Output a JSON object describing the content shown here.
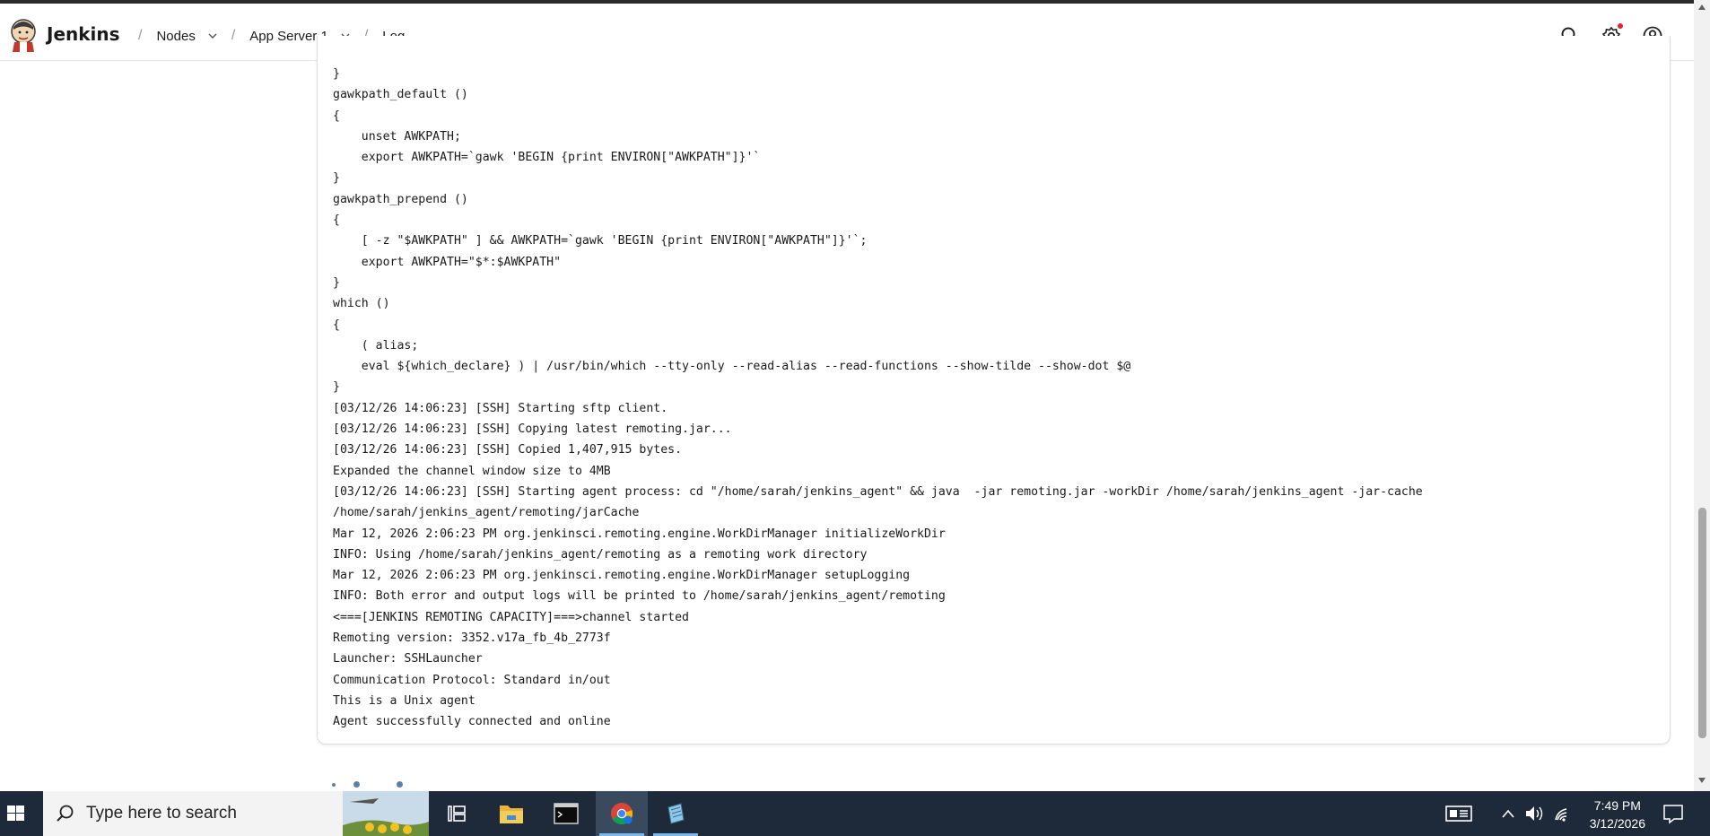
{
  "header": {
    "brand": "Jenkins",
    "breadcrumbs": [
      {
        "label": "Nodes",
        "has_menu": true
      },
      {
        "label": "App Server 1",
        "has_menu": true
      },
      {
        "label": "Log",
        "has_menu": false
      }
    ],
    "separator": "/",
    "icons": [
      "search-icon",
      "settings-icon",
      "user-icon"
    ],
    "notification_color": "#e5222e"
  },
  "log": {
    "lines": [
      "}",
      "gawkpath_default ()",
      "{",
      "    unset AWKPATH;",
      "    export AWKPATH=`gawk 'BEGIN {print ENVIRON[\"AWKPATH\"]}'`",
      "}",
      "gawkpath_prepend ()",
      "{",
      "    [ -z \"$AWKPATH\" ] && AWKPATH=`gawk 'BEGIN {print ENVIRON[\"AWKPATH\"]}'`;",
      "    export AWKPATH=\"$*:$AWKPATH\"",
      "}",
      "which ()",
      "{",
      "    ( alias;",
      "    eval ${which_declare} ) | /usr/bin/which --tty-only --read-alias --read-functions --show-tilde --show-dot $@",
      "}",
      "[03/12/26 14:06:23] [SSH] Starting sftp client.",
      "[03/12/26 14:06:23] [SSH] Copying latest remoting.jar...",
      "[03/12/26 14:06:23] [SSH] Copied 1,407,915 bytes.",
      "Expanded the channel window size to 4MB",
      "[03/12/26 14:06:23] [SSH] Starting agent process: cd \"/home/sarah/jenkins_agent\" && java  -jar remoting.jar -workDir /home/sarah/jenkins_agent -jar-cache",
      "/home/sarah/jenkins_agent/remoting/jarCache",
      "Mar 12, 2026 2:06:23 PM org.jenkinsci.remoting.engine.WorkDirManager initializeWorkDir",
      "INFO: Using /home/sarah/jenkins_agent/remoting as a remoting work directory",
      "Mar 12, 2026 2:06:23 PM org.jenkinsci.remoting.engine.WorkDirManager setupLogging",
      "INFO: Both error and output logs will be printed to /home/sarah/jenkins_agent/remoting",
      "<===[JENKINS REMOTING CAPACITY]===>channel started",
      "Remoting version: 3352.v17a_fb_4b_2773f",
      "Launcher: SSHLauncher",
      "Communication Protocol: Standard in/out",
      "This is a Unix agent",
      "Agent successfully connected and online"
    ]
  },
  "taskbar": {
    "search_placeholder": "Type here to search",
    "apps": [
      "task-view-icon",
      "file-explorer-icon",
      "terminal-icon",
      "chrome-icon",
      "notepad-icon"
    ],
    "time": "7:49 PM",
    "date": "3/12/2026",
    "accent": "#76b9ed"
  }
}
